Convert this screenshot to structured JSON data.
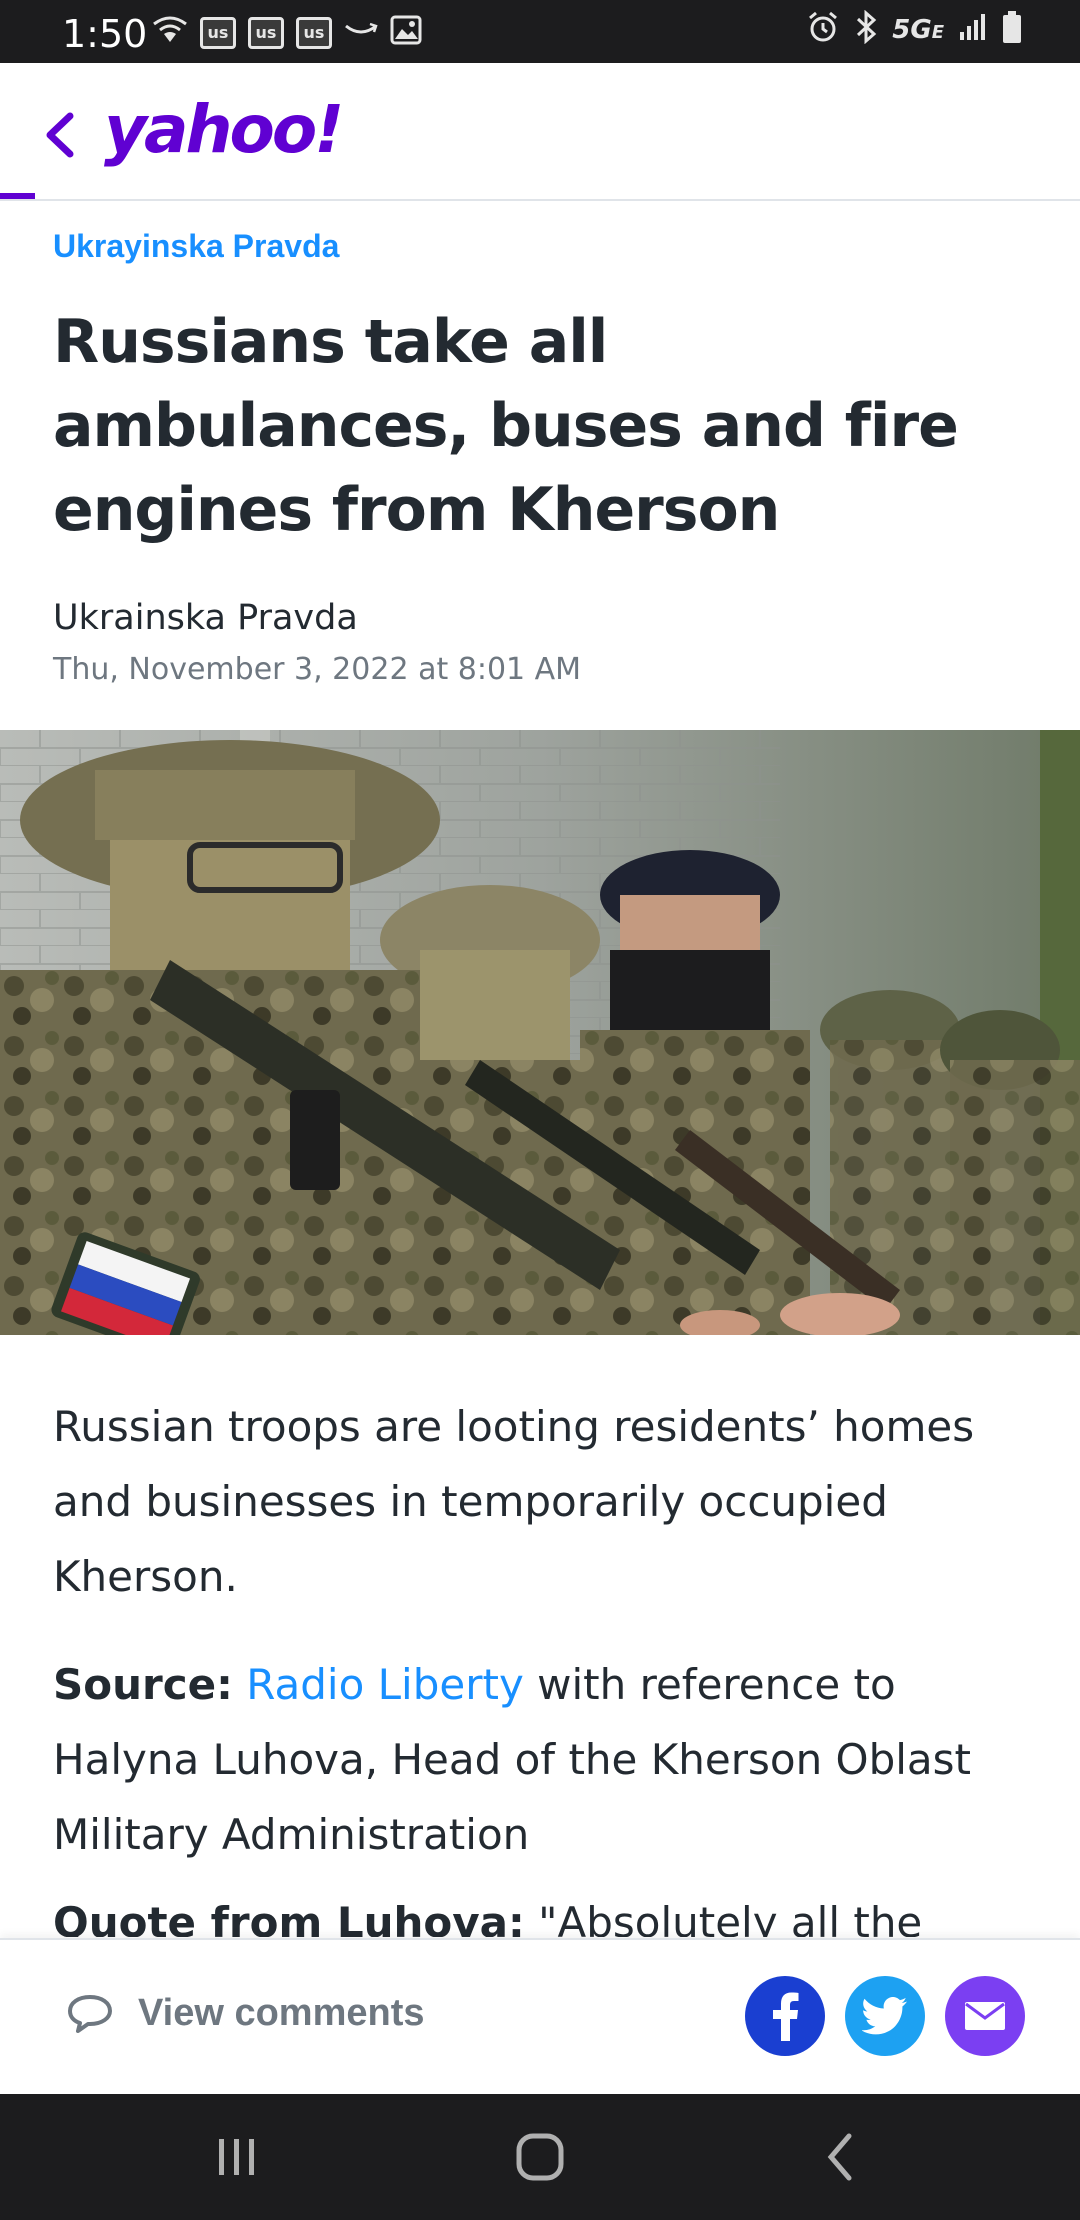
{
  "status_bar": {
    "time": "1:50",
    "network": "5G",
    "network_sub": "E",
    "badges": [
      "us",
      "us",
      "us"
    ]
  },
  "header": {
    "logo": "yahoo!",
    "accent_color": "#6001d2"
  },
  "article": {
    "provider": "Ukrayinska Pravda",
    "headline": "Russians take all ambulances, buses and fire engines from Kherson",
    "author": "Ukrainska Pravda",
    "date": "Thu, November 3, 2022 at 8:01 AM",
    "paragraph1": "Russian troops are looting residents’ homes and businesses in temporarily occupied Kherson.",
    "source_label": "Source:",
    "source_link": "Radio Liberty",
    "source_rest": " with reference to Halyna Luhova, Head of the Kherson Oblast Military Administration",
    "quote_label": "Quote from Luhova:",
    "quote_text": " \"Absolutely all the"
  },
  "action_bar": {
    "view_comments": "View comments"
  },
  "colors": {
    "link": "#188fff",
    "text": "#232a31",
    "muted": "#6e7780",
    "facebook": "#1a3fd1",
    "twitter": "#1da1f2",
    "mail": "#7b3ff2"
  }
}
